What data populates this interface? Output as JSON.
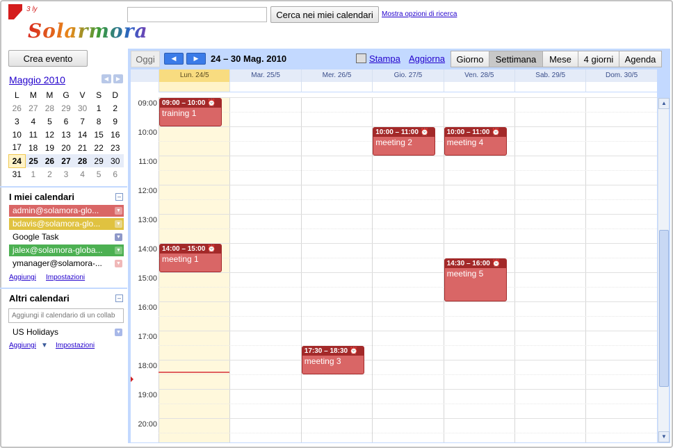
{
  "header": {
    "logo_text": "Solarmora",
    "logo_mark": "3 ly",
    "search_placeholder": "",
    "search_button": "Cerca nei miei calendari",
    "search_options": "Mostra opzioni di ricerca"
  },
  "sidebar": {
    "create_event": "Crea evento",
    "mini_cal": {
      "title": "Maggio 2010",
      "weekdays": [
        "L",
        "M",
        "M",
        "G",
        "V",
        "S",
        "D"
      ],
      "weeks": [
        [
          "26",
          "27",
          "28",
          "29",
          "30",
          "1",
          "2"
        ],
        [
          "3",
          "4",
          "5",
          "6",
          "7",
          "8",
          "9"
        ],
        [
          "10",
          "11",
          "12",
          "13",
          "14",
          "15",
          "16"
        ],
        [
          "17",
          "18",
          "19",
          "20",
          "21",
          "22",
          "23"
        ],
        [
          "24",
          "25",
          "26",
          "27",
          "28",
          "29",
          "30"
        ],
        [
          "31",
          "1",
          "2",
          "3",
          "4",
          "5",
          "6"
        ]
      ]
    },
    "my_calendars": {
      "title": "I miei calendari",
      "items": [
        {
          "label": "admin@solamora-glo...",
          "color": "#d96666",
          "text_color": "#ffffff"
        },
        {
          "label": "bdavis@solamora-glo...",
          "color": "#e0c240",
          "text_color": "#ffffff"
        },
        {
          "label": "Google Task",
          "color": "",
          "text_color": "#000000"
        },
        {
          "label": "jalex@solamora-globa...",
          "color": "#4cb052",
          "text_color": "#ffffff"
        },
        {
          "label": "ymanager@solamora-...",
          "color": "",
          "text_color": "#000000"
        }
      ],
      "add_link": "Aggiungi",
      "settings_link": "Impostazioni"
    },
    "other_calendars": {
      "title": "Altri calendari",
      "add_placeholder": "Aggiungi il calendario di un collab",
      "items": [
        {
          "label": "US Holidays"
        }
      ],
      "add_link": "Aggiungi",
      "settings_link": "Impostazioni"
    }
  },
  "toolbar": {
    "today": "Oggi",
    "prev_icon": "◀",
    "next_icon": "▶",
    "date_range": "24 – 30 Mag. 2010",
    "print": "Stampa",
    "refresh": "Aggiorna",
    "views": [
      "Giorno",
      "Settimana",
      "Mese",
      "4 giorni",
      "Agenda"
    ],
    "active_view": "Settimana"
  },
  "week": {
    "days": [
      "Lun. 24/5",
      "Mar. 25/5",
      "Mer. 26/5",
      "Gio. 27/5",
      "Ven. 28/5",
      "Sab. 29/5",
      "Dom. 30/5"
    ],
    "today_index": 0,
    "hours": [
      "09:00",
      "10:00",
      "11:00",
      "12:00",
      "13:00",
      "14:00",
      "15:00",
      "16:00",
      "17:00",
      "18:00",
      "19:00",
      "20:00"
    ]
  },
  "events": [
    {
      "day": 0,
      "start": 9.0,
      "end": 10.0,
      "time": "09:00 – 10:00",
      "title": "training 1"
    },
    {
      "day": 3,
      "start": 10.0,
      "end": 11.0,
      "time": "10:00 – 11:00",
      "title": "meeting 2"
    },
    {
      "day": 4,
      "start": 10.0,
      "end": 11.0,
      "time": "10:00 – 11:00",
      "title": "meeting 4"
    },
    {
      "day": 0,
      "start": 14.0,
      "end": 15.0,
      "time": "14:00 – 15:00",
      "title": "meeting 1"
    },
    {
      "day": 4,
      "start": 14.5,
      "end": 16.0,
      "time": "14:30 – 16:00",
      "title": "meeting 5"
    },
    {
      "day": 2,
      "start": 17.5,
      "end": 18.5,
      "time": "17:30 – 18:30",
      "title": "meeting 3"
    }
  ],
  "now_hour": 18.4,
  "colors": {
    "event_bg": "#d96666",
    "event_head": "#a32929",
    "today_bg": "#fff8dc",
    "accent": "#c3d9ff"
  }
}
